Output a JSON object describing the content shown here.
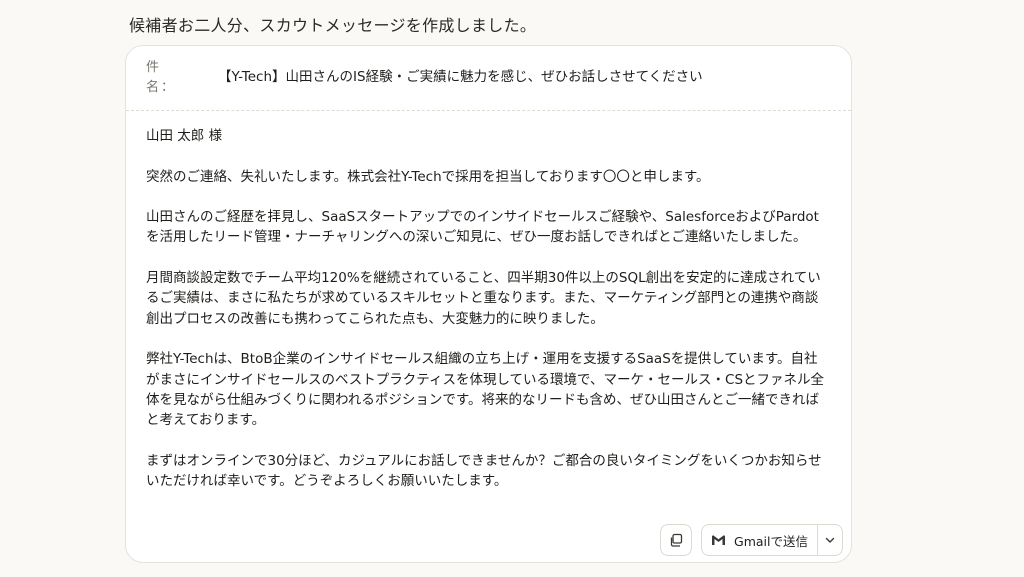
{
  "intro": "候補者お二人分、スカウトメッセージを作成しました。",
  "email": {
    "subject_label": "件名：",
    "subject": "【Y-Tech】山田さんのIS経験・ご実績に魅力を感じ、ぜひお話しさせてください",
    "paragraphs": [
      "山田 太郎 様",
      "突然のご連絡、失礼いたします。株式会社Y-Techで採用を担当しております〇〇と申します。",
      "山田さんのご経歴を拝見し、SaaSスタートアップでのインサイドセールスご経験や、SalesforceおよびPardotを活用したリード管理・ナーチャリングへの深いご知見に、ぜひ一度お話しできればとご連絡いたしました。",
      "月間商談設定数でチーム平均120%を継続されていること、四半期30件以上のSQL創出を安定的に達成されているご実績は、まさに私たちが求めているスキルセットと重なります。また、マーケティング部門との連携や商談創出プロセスの改善にも携わってこられた点も、大変魅力的に映りました。",
      "弊社Y-Techは、BtoB企業のインサイドセールス組織の立ち上げ・運用を支援するSaaSを提供しています。自社がまさにインサイドセールスのベストプラクティスを体現している環境で、マーケ・セールス・CSとファネル全体を見ながら仕組みづくりに関われるポジションです。将来的なリードも含め、ぜひ山田さんとご一緒できればと考えております。",
      "まずはオンラインで30分ほど、カジュアルにお話しできませんか？ご都合の良いタイミングをいくつかお知らせいただければ幸いです。どうぞよろしくお願いいたします。"
    ]
  },
  "actions": {
    "copy_icon": "copy-icon",
    "gmail_icon": "gmail-icon",
    "send_label": "Gmailで送信",
    "menu_icon": "chevron-down-icon"
  },
  "colors": {
    "background": "#faf9f5",
    "card": "#ffffff",
    "border": "#e6e3da",
    "text": "#1f1e1b",
    "muted": "#7a776f"
  }
}
